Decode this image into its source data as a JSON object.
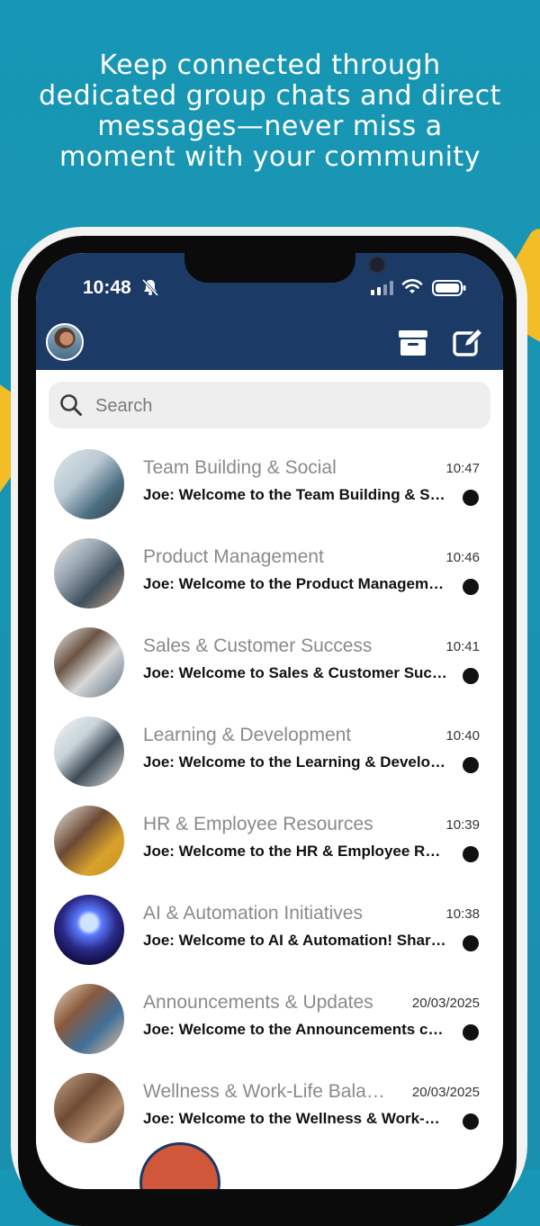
{
  "headline": "Keep connected through dedicated group chats and direct messages—never miss a moment with your community",
  "status_bar": {
    "time": "10:48",
    "icons": [
      "bell-muted-icon",
      "signal-icon",
      "wifi-icon",
      "battery-icon"
    ]
  },
  "header": {
    "icons": [
      "avatar",
      "archive-icon",
      "compose-icon"
    ]
  },
  "search": {
    "placeholder": "Search"
  },
  "chats": [
    {
      "name": "Team Building & Social",
      "time": "10:47",
      "preview": "Joe: Welcome to the Team Building & Social group!",
      "unread": true
    },
    {
      "name": "Product Management",
      "time": "10:46",
      "preview": "Joe: Welcome to the Product Management group!",
      "unread": true
    },
    {
      "name": "Sales & Customer Success",
      "time": "10:41",
      "preview": "Joe: Welcome to Sales & Customer Success!",
      "unread": true
    },
    {
      "name": "Learning & Development",
      "time": "10:40",
      "preview": "Joe: Welcome to the Learning & Development group!",
      "unread": true
    },
    {
      "name": "HR & Employee Resources",
      "time": "10:39",
      "preview": "Joe: Welcome to the HR & Employee Resources group!",
      "unread": true
    },
    {
      "name": "AI & Automation Initiatives",
      "time": "10:38",
      "preview": "Joe: Welcome to AI & Automation! Share your ideas.",
      "unread": true
    },
    {
      "name": "Announcements & Updates",
      "time": "20/03/2025",
      "preview": "Joe: Welcome to the Announcements channel!",
      "unread": true
    },
    {
      "name": "Wellness & Work-Life Balance",
      "time": "20/03/2025",
      "preview": "Joe: Welcome to the Wellness & Work-Life Balance group!",
      "unread": true
    }
  ],
  "colors": {
    "background": "#1797b5",
    "header": "#1b3a66",
    "accent": "#f2bd27",
    "fab": "#d0573a"
  }
}
